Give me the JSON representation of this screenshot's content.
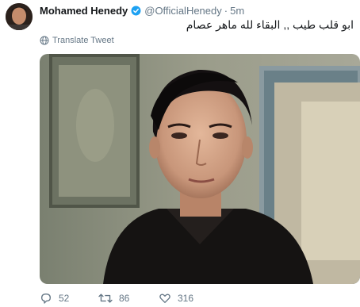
{
  "tweet": {
    "display_name": "Mohamed Henedy",
    "handle": "@OfficialHenedy",
    "separator": "·",
    "time": "5m",
    "text": "ابو قلب طيب ,, البقاء لله ماهر عصام",
    "translate_label": "Translate Tweet",
    "verified_icon": "verified-badge-icon",
    "media_description_icon": "photo"
  },
  "actions": {
    "reply_count": "52",
    "retweet_count": "86",
    "like_count": "316"
  },
  "colors": {
    "text_primary": "#14171a",
    "text_secondary": "#657786",
    "verified_blue": "#1da1f2"
  }
}
